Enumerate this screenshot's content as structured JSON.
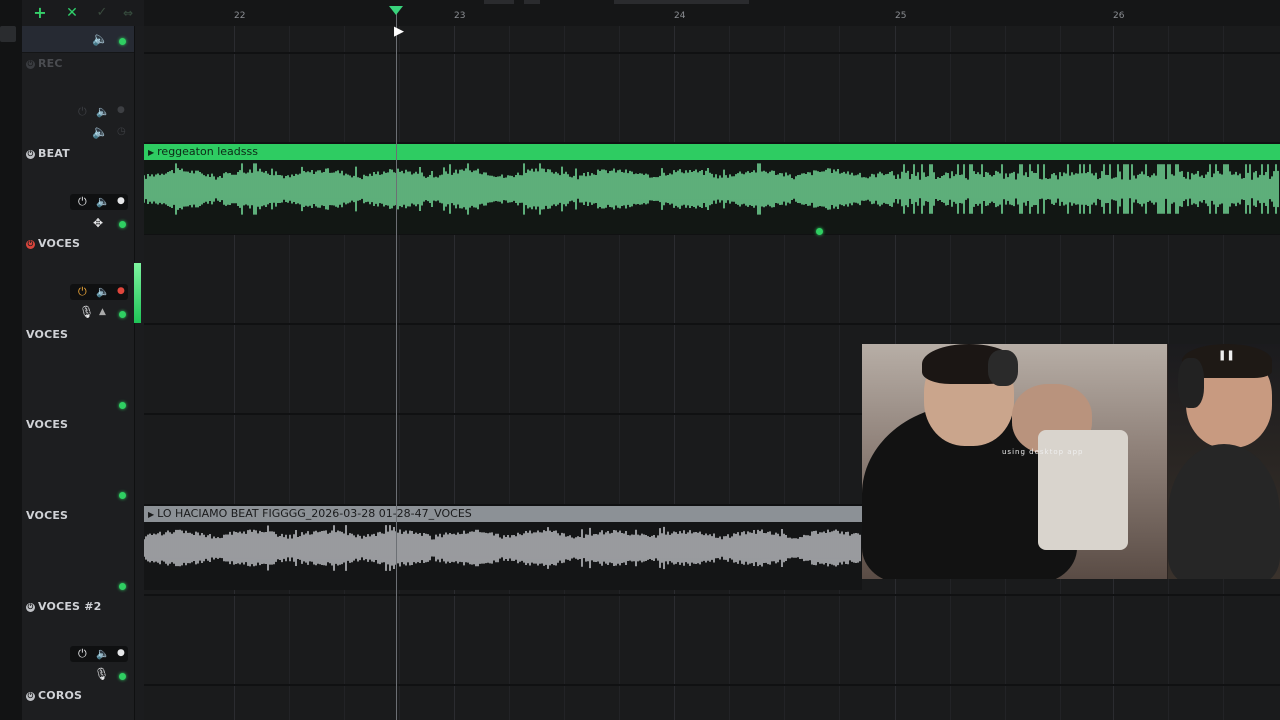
{
  "toolbar": {
    "add_label": "+",
    "close_label": "✕",
    "check_label": "✓",
    "link_label": "⇔"
  },
  "ruler": {
    "bars": [
      "22",
      "23",
      "24",
      "25",
      "26"
    ]
  },
  "tracks": {
    "rec": {
      "name": "REC"
    },
    "beat": {
      "name": "BEAT",
      "clip_label": "reggeaton leadsss"
    },
    "voces1": {
      "name": "VOCES"
    },
    "voces2": {
      "name": "VOCES"
    },
    "voces3": {
      "name": "VOCES"
    },
    "voces4": {
      "name": "VOCES",
      "clip_label": "LO HACIAMO BEAT FIGGGG_2026-03-28 01-28-47_VOCES"
    },
    "voces5": {
      "name": "VOCES #2"
    },
    "coros": {
      "name": "COROS"
    }
  },
  "webcam": {
    "overlay_text": "using desktop app"
  },
  "icons": {
    "power": "power-icon",
    "speaker": "speaker-icon",
    "record": "record-dot-icon",
    "mic": "microphone-icon",
    "arrow": "arrow-up-icon"
  },
  "colors": {
    "beat_clip": "#2ecc62",
    "beat_wave": "#7ef0a6",
    "vocal_clip": "#8c9196",
    "vocal_wave": "#d2d4d8",
    "playhead_marker": "#39d37c",
    "rec_red": "#d9453c"
  }
}
